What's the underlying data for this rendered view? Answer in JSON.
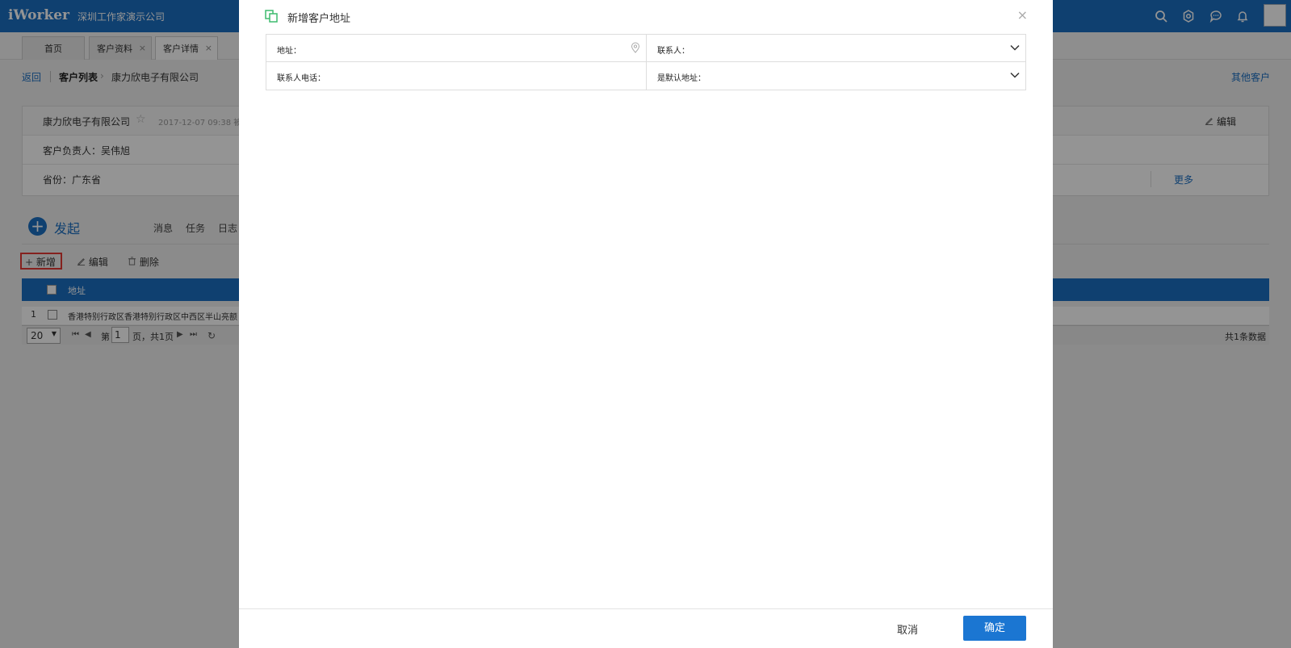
{
  "app": {
    "logo": "iWorker",
    "company": "深圳工作家演示公司"
  },
  "top_icons": [
    "search-icon",
    "settings-icon",
    "chat-icon",
    "bell-icon"
  ],
  "tabs": [
    {
      "label": "首页",
      "closable": false
    },
    {
      "label": "客户资料",
      "closable": true
    },
    {
      "label": "客户详情",
      "closable": true
    }
  ],
  "tab_close": "×",
  "breadcrumb": {
    "back": "返回",
    "list": "客户列表",
    "arrow": "›",
    "current": "康力欣电子有限公司",
    "other": "其他客户"
  },
  "customer": {
    "name": "康力欣电子有限公司",
    "star": "☆",
    "date": "2017-12-07 09:38 被",
    "owner": "客户负责人：吴伟旭",
    "province": "省份：广东省",
    "edit": "编辑",
    "more": "更多"
  },
  "launch": {
    "label": "发起",
    "plus": "+",
    "links": [
      "消息",
      "任务",
      "日志"
    ]
  },
  "toolbar": {
    "add": "新增",
    "edit": "编辑",
    "delete": "删除"
  },
  "grid": {
    "header_address": "地址",
    "rows": [
      {
        "num": "1",
        "address": "香港特别行政区香港特别行政区中西区半山亮额"
      }
    ]
  },
  "pager": {
    "size": "20",
    "page_prefix": "第",
    "page": "1",
    "page_suffix": "页，共1页",
    "total": "共1条数据"
  },
  "modal": {
    "title": "新增客户地址",
    "close": "×",
    "fields": {
      "address": "地址：",
      "contact": "联系人：",
      "phone": "联系人电话：",
      "default_address": "是默认地址："
    },
    "cancel": "取消",
    "confirm": "确定"
  },
  "colors": {
    "brand": "#1b6ec2",
    "primary_button": "#1b76d2",
    "highlight": "#e53935",
    "icon_green": "#3dbb6e"
  }
}
